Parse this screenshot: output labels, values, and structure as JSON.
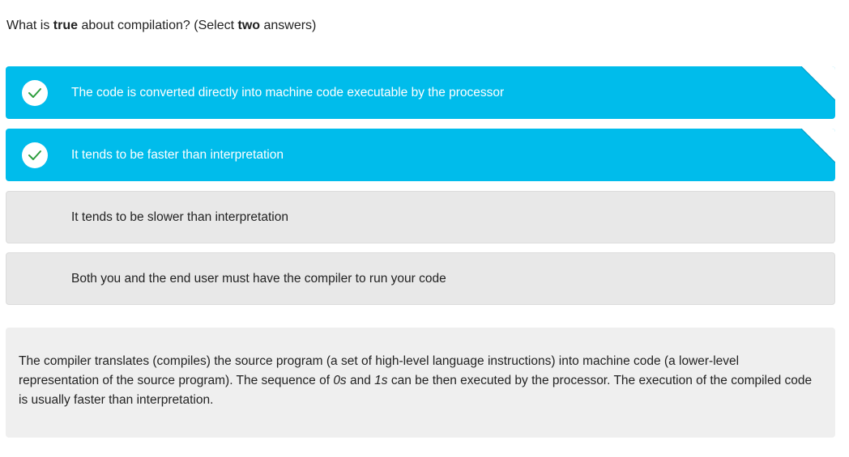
{
  "question": {
    "part1": "What is ",
    "bold1": "true",
    "part2": " about compilation? (Select ",
    "bold2": "two",
    "part3": " answers)"
  },
  "options": [
    {
      "label": "The code is converted directly into machine code executable by the processor",
      "selected": true
    },
    {
      "label": "It tends to be faster than interpretation",
      "selected": true
    },
    {
      "label": "It tends to be slower than interpretation",
      "selected": false
    },
    {
      "label": "Both you and the end user must have the compiler to run your code",
      "selected": false
    }
  ],
  "explanation": {
    "t1": "The compiler translates (compiles) the source program (a set of high-level language instructions) into machine code (a lower-level representation of the source program). The sequence of ",
    "i1": "0s",
    "t2": " and ",
    "i2": "1s",
    "t3": " can be then executed by the processor. The execution of the compiled code is usually faster than interpretation."
  },
  "colors": {
    "selected": "#00bceb",
    "unselected": "#e8e8e8",
    "check": "#2e9e3e",
    "explanation_bg": "#efefef"
  },
  "icons": {
    "check": "check-icon",
    "corner": "corner-fold-icon"
  }
}
